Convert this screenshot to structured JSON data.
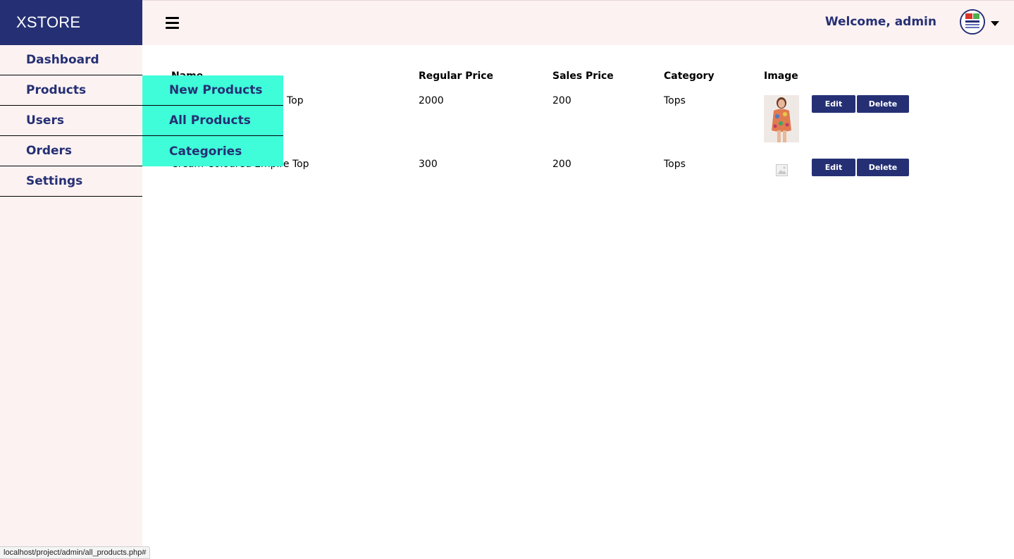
{
  "brand": {
    "name": "XSTORE"
  },
  "header": {
    "welcome": "Welcome, admin"
  },
  "sidebar": {
    "items": [
      {
        "label": "Dashboard"
      },
      {
        "label": "Products"
      },
      {
        "label": "Users"
      },
      {
        "label": "Orders"
      },
      {
        "label": "Settings"
      }
    ]
  },
  "products_submenu": {
    "items": [
      {
        "label": "New Products"
      },
      {
        "label": "All Products"
      },
      {
        "label": "Categories"
      }
    ]
  },
  "table": {
    "headers": {
      "name": "Name",
      "regular_price": "Regular Price",
      "sales_price": "Sales Price",
      "category": "Category",
      "image": "Image"
    },
    "rows": [
      {
        "name": "Top",
        "regular_price": "2000",
        "sales_price": "200",
        "category": "Tops",
        "image": "product-photo-floral-top",
        "edit": "Edit",
        "delete": "Delete"
      },
      {
        "name": "Cream-Coloured Empire Top",
        "regular_price": "300",
        "sales_price": "200",
        "category": "Tops",
        "image": "image-placeholder-icon",
        "edit": "Edit",
        "delete": "Delete"
      }
    ]
  },
  "status_bar": {
    "url": "localhost/project/admin/all_products.php#"
  },
  "colors": {
    "primary": "#253074",
    "submenu_bg": "#3ffdd9",
    "panel_bg": "#fdf2f2"
  }
}
